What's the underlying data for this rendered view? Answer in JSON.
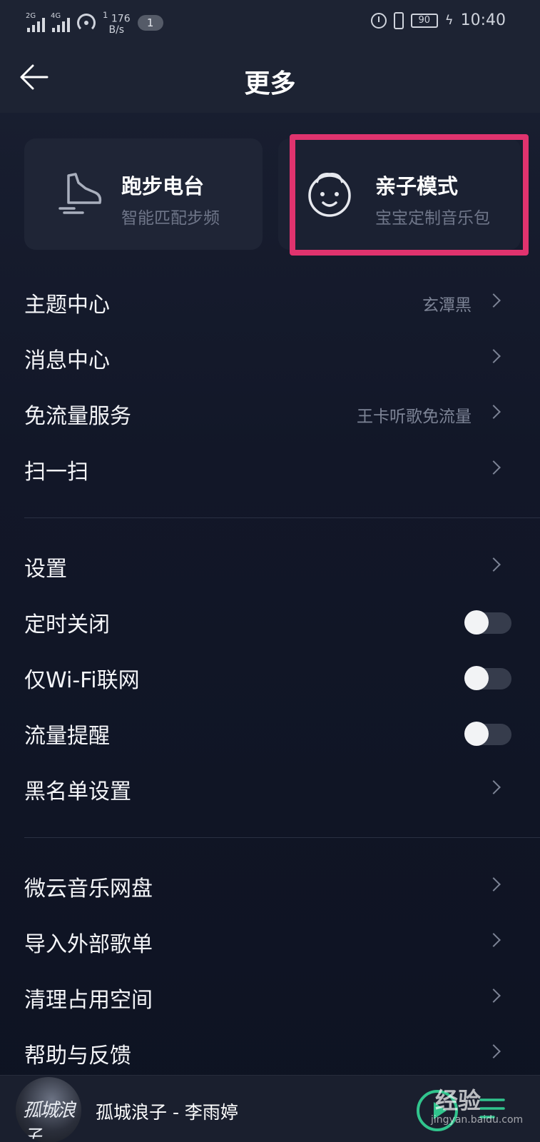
{
  "status_bar": {
    "net1": "2G",
    "net2": "4G",
    "speed_value": "176",
    "speed_unit": "B/s",
    "speed_superscript": "1",
    "notification_count": "1",
    "battery": "90",
    "time": "10:40"
  },
  "header": {
    "title": "更多"
  },
  "cards": {
    "running": {
      "title": "跑步电台",
      "subtitle": "智能匹配步频"
    },
    "kids": {
      "title": "亲子模式",
      "subtitle": "宝宝定制音乐包"
    }
  },
  "group1": [
    {
      "label": "主题中心",
      "value": "玄潭黑"
    },
    {
      "label": "消息中心",
      "value": ""
    },
    {
      "label": "免流量服务",
      "value": "王卡听歌免流量"
    },
    {
      "label": "扫一扫",
      "value": ""
    }
  ],
  "group2": [
    {
      "label": "设置"
    },
    {
      "label": "定时关闭",
      "toggle_on": false
    },
    {
      "label": "仅Wi-Fi联网",
      "toggle_on": false
    },
    {
      "label": "流量提醒",
      "toggle_on": false
    },
    {
      "label": "黑名单设置"
    }
  ],
  "group3": [
    {
      "label": "微云音乐网盘"
    },
    {
      "label": "导入外部歌单"
    },
    {
      "label": "清理占用空间"
    },
    {
      "label": "帮助与反馈"
    }
  ],
  "player": {
    "song": "孤城浪子 - 李雨婷",
    "art_text": "孤城浪子",
    "watermark": "经验",
    "watermark_sub": "jingyan.baidu.com"
  },
  "colors": {
    "accent_green": "#31c48d",
    "highlight": "#e0336e"
  }
}
